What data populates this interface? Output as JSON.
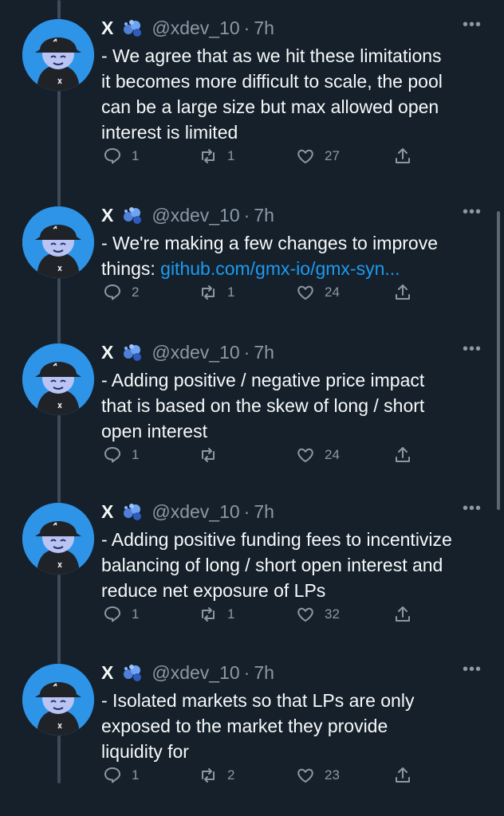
{
  "tweets": [
    {
      "name": "X",
      "handle": "@xdev_10",
      "time": "7h",
      "lines": [
        "- We agree that as we hit these limitations",
        "it becomes more difficult to scale, the pool",
        "can be a large size but max allowed open",
        "interest is limited"
      ],
      "link": "",
      "replies": "1",
      "retweets": "1",
      "likes": "27"
    },
    {
      "name": "X",
      "handle": "@xdev_10",
      "time": "7h",
      "lines": [
        "- We're making a few changes to improve",
        "things: "
      ],
      "link": "github.com/gmx-io/gmx-syn...",
      "replies": "2",
      "retweets": "1",
      "likes": "24"
    },
    {
      "name": "X",
      "handle": "@xdev_10",
      "time": "7h",
      "lines": [
        "- Adding positive / negative price impact",
        "that is based on the skew of long / short",
        "open interest"
      ],
      "link": "",
      "replies": "1",
      "retweets": "",
      "likes": "24"
    },
    {
      "name": "X",
      "handle": "@xdev_10",
      "time": "7h",
      "lines": [
        "- Adding positive funding fees to incentivize",
        "balancing of long / short open interest and",
        "reduce net exposure of LPs"
      ],
      "link": "",
      "replies": "1",
      "retweets": "1",
      "likes": "32"
    },
    {
      "name": "X",
      "handle": "@xdev_10",
      "time": "7h",
      "lines": [
        "- Isolated markets so that LPs are only",
        "exposed to the market they provide",
        "liquidity for"
      ],
      "link": "",
      "replies": "1",
      "retweets": "2",
      "likes": "23"
    }
  ],
  "dot": "·",
  "more": "•••",
  "colors": {
    "background": "#15202b",
    "link": "#1d9bf0",
    "muted": "#8b98a5",
    "avatar": "#2e94e8"
  }
}
